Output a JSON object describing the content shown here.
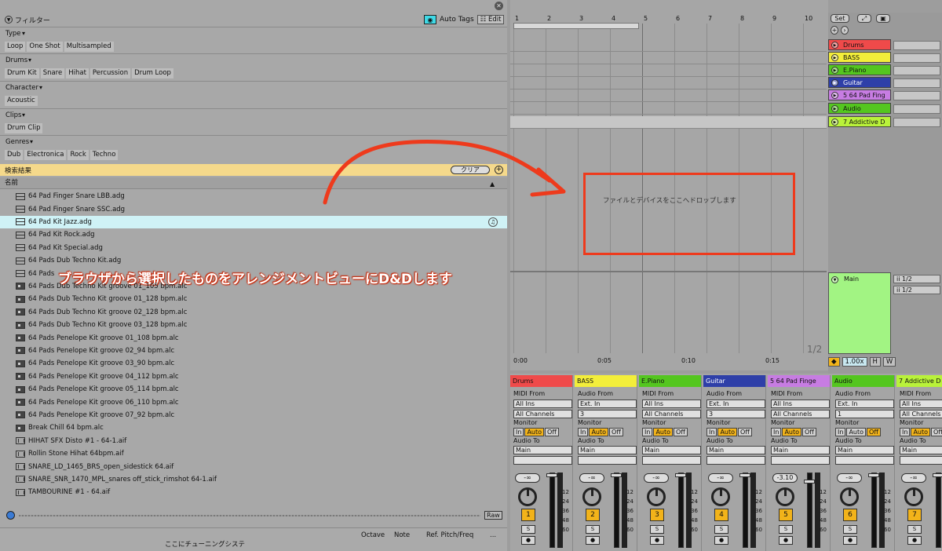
{
  "browser": {
    "filter_title": "フィルター",
    "auto_tags": "Auto Tags",
    "edit": "Edit",
    "sections": [
      {
        "label": "Type",
        "chips": [
          "Loop",
          "One Shot",
          "Multisampled"
        ]
      },
      {
        "label": "Drums",
        "chips": [
          "Drum Kit",
          "Snare",
          "Hihat",
          "Percussion",
          "Drum Loop"
        ]
      },
      {
        "label": "Character",
        "chips": [
          "Acoustic"
        ]
      },
      {
        "label": "Clips",
        "chips": [
          "Drum Clip"
        ]
      },
      {
        "label": "Genres",
        "chips": [
          "Dub",
          "Electronica",
          "Rock",
          "Techno"
        ]
      }
    ],
    "results_label": "検索結果",
    "clear": "クリア",
    "name_col": "名前",
    "files": [
      {
        "name": "64 Pad Finger Snare LBB.adg",
        "icon": "rack-icon"
      },
      {
        "name": "64 Pad Finger Snare SSC.adg",
        "icon": "rack-icon"
      },
      {
        "name": "64 Pad Kit Jazz.adg",
        "icon": "rack-icon",
        "selected": true
      },
      {
        "name": "64 Pad Kit Rock.adg",
        "icon": "rack-icon"
      },
      {
        "name": "64 Pad Kit Special.adg",
        "icon": "rack-icon"
      },
      {
        "name": "64 Pads Dub Techno Kit.adg",
        "icon": "rack-icon"
      },
      {
        "name": "64 Pads",
        "icon": "rack-icon"
      },
      {
        "name": "64 Pads Dub Techno Kit groove 01_105 bpm.alc",
        "icon": "clip-icon"
      },
      {
        "name": "64 Pads Dub Techno Kit groove 01_128 bpm.alc",
        "icon": "clip-icon"
      },
      {
        "name": "64 Pads Dub Techno Kit groove 02_128 bpm.alc",
        "icon": "clip-icon"
      },
      {
        "name": "64 Pads Dub Techno Kit groove 03_128 bpm.alc",
        "icon": "clip-icon"
      },
      {
        "name": "64 Pads Penelope Kit groove 01_108 bpm.alc",
        "icon": "clip-icon"
      },
      {
        "name": "64 Pads Penelope Kit groove 02_94 bpm.alc",
        "icon": "clip-icon"
      },
      {
        "name": "64 Pads Penelope Kit groove 03_90 bpm.alc",
        "icon": "clip-icon"
      },
      {
        "name": "64 Pads Penelope Kit groove 04_112 bpm.alc",
        "icon": "clip-icon"
      },
      {
        "name": "64 Pads Penelope Kit groove 05_114 bpm.alc",
        "icon": "clip-icon"
      },
      {
        "name": "64 Pads Penelope Kit groove 06_110 bpm.alc",
        "icon": "clip-icon"
      },
      {
        "name": "64 Pads Penelope Kit groove 07_92 bpm.alc",
        "icon": "clip-icon"
      },
      {
        "name": "Break Chill 64 bpm.alc",
        "icon": "clip-icon"
      },
      {
        "name": "HIHAT SFX Disto #1 - 64-1.aif",
        "icon": "audio-file-icon"
      },
      {
        "name": "Rollin Stone Hihat 64bpm.aif",
        "icon": "audio-file-icon"
      },
      {
        "name": "SNARE_LD_1465_BRS_open_sidestick 64.aif",
        "icon": "audio-file-icon"
      },
      {
        "name": "SNARE_SNR_1470_MPL_snares off_stick_rimshot 64-1.aif",
        "icon": "audio-file-icon"
      },
      {
        "name": "TAMBOURINE #1 - 64.aif",
        "icon": "audio-file-icon"
      }
    ],
    "raw": "Raw",
    "status": {
      "tuning": "ここにチューニングシステ",
      "octave": "Octave",
      "note": "Note",
      "pitch": "Ref. Pitch/Freq",
      "dots": "..."
    }
  },
  "annotation": {
    "caption": "ブラウザから選択したものをアレンジメントビューにD&Dします",
    "accent": "#ee3a1c"
  },
  "arrangement": {
    "bars": [
      "1",
      "2",
      "3",
      "4",
      "5",
      "6",
      "7",
      "8",
      "9",
      "10"
    ],
    "times": [
      "0:00",
      "0:05",
      "0:10",
      "0:15"
    ],
    "drop_hint": "ファイルとデバイスをここへドロップします",
    "page": "1/2"
  },
  "tracks": {
    "set": "Set",
    "list": [
      {
        "name": "Drums",
        "color": "#ef4a4a"
      },
      {
        "name": "BASS",
        "color": "#f3ee3a"
      },
      {
        "name": "E.Piano",
        "color": "#54c61f"
      },
      {
        "name": "Guitar",
        "color": "#2e3fa8",
        "text": "#fff"
      },
      {
        "name": "5 64 Pad Fing",
        "color": "#c77ce2"
      },
      {
        "name": "Audio",
        "color": "#54c61f"
      },
      {
        "name": "7 Addictive D",
        "color": "#b9f23a"
      }
    ],
    "main": "Main",
    "main_sel": [
      "1/2",
      "1/2"
    ],
    "tempo": "1.00x",
    "h": "H",
    "w": "W"
  },
  "mixer": {
    "strips": [
      {
        "name": "Drums",
        "color": "#ef4a4a",
        "src_label": "MIDI From",
        "src": "All Ins",
        "ch": "All Channels",
        "on": "Auto",
        "out": "Main",
        "vol": "-∞",
        "num": "1"
      },
      {
        "name": "BASS",
        "color": "#f3ee3a",
        "src_label": "Audio From",
        "src": "Ext. In",
        "ch": "3",
        "on": "Auto",
        "out": "Main",
        "vol": "-∞",
        "num": "2"
      },
      {
        "name": "E.Piano",
        "color": "#54c61f",
        "src_label": "MIDI From",
        "src": "All Ins",
        "ch": "All Channels",
        "on": "Auto",
        "out": "Main",
        "vol": "-∞",
        "num": "3"
      },
      {
        "name": "Guitar",
        "color": "#2e3fa8",
        "text": "#fff",
        "src_label": "Audio From",
        "src": "Ext. In",
        "ch": "3",
        "on": "Auto",
        "out": "Main",
        "vol": "-∞",
        "num": "4"
      },
      {
        "name": "5 64 Pad Finge",
        "color": "#c77ce2",
        "src_label": "MIDI From",
        "src": "All Ins",
        "ch": "All Channels",
        "on": "Auto",
        "out": "Main",
        "vol": "-3.10",
        "num": "5"
      },
      {
        "name": "Audio",
        "color": "#54c61f",
        "src_label": "Audio From",
        "src": "Ext. In",
        "ch": "1",
        "on": "Off",
        "out": "Main",
        "vol": "-∞",
        "num": "6"
      },
      {
        "name": "7 Addictive D",
        "color": "#b9f23a",
        "src_label": "MIDI From",
        "src": "All Ins",
        "ch": "All Channels",
        "on": "Auto",
        "out": "Main",
        "vol": "-∞",
        "num": "7"
      }
    ],
    "labels": {
      "monitor": "Monitor",
      "audio_to": "Audio To",
      "in": "In",
      "auto": "Auto",
      "off": "Off",
      "s": "S"
    },
    "scale": [
      "12",
      "24",
      "36",
      "48",
      "60"
    ]
  }
}
